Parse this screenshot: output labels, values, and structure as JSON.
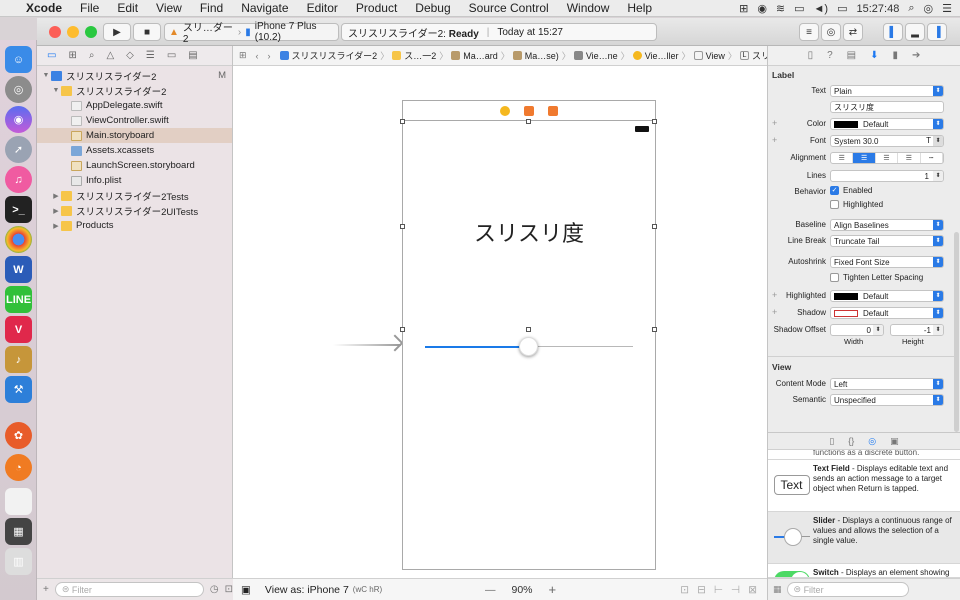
{
  "menubar": {
    "app": "Xcode",
    "items": [
      "File",
      "Edit",
      "View",
      "Find",
      "Navigate",
      "Editor",
      "Product",
      "Debug",
      "Source Control",
      "Window",
      "Help"
    ],
    "clock": "15:27:48"
  },
  "toolbar": {
    "scheme": "スリ…ダー2",
    "device": "iPhone 7 Plus (10.2)",
    "status_project": "スリスリスライダー2:",
    "status_state": "Ready",
    "status_time": "Today at 15:27"
  },
  "navigator": {
    "project": "スリスリスライダー2",
    "project_badge": "M",
    "group": "スリスリスライダー2",
    "files": [
      "AppDelegate.swift",
      "ViewController.swift",
      "Main.storyboard",
      "Assets.xcassets",
      "LaunchScreen.storyboard",
      "Info.plist"
    ],
    "groups": [
      "スリスリスライダー2Tests",
      "スリスリスライダー2UITests",
      "Products"
    ],
    "filter_placeholder": "Filter"
  },
  "jumpbar": {
    "crumbs": [
      "スリスリスライダー2",
      "ス…一2",
      "Ma…ard",
      "Ma…se)",
      "Vie…ne",
      "Vie…ller",
      "View",
      "スリスリ度"
    ]
  },
  "canvas": {
    "label_text": "スリスリ度",
    "slider_value": 0.5,
    "view_as": "View as: iPhone 7",
    "size_class": "(wC hR)",
    "zoom": "90%",
    "zoom_minus": "—",
    "zoom_plus": "+"
  },
  "inspector": {
    "section_label": "Label",
    "text_label": "Text",
    "text_value": "Plain",
    "text_content": "スリスリ度",
    "color_label": "Color",
    "color_value": "Default",
    "font_label": "Font",
    "font_value": "System 30.0",
    "alignment_label": "Alignment",
    "lines_label": "Lines",
    "lines_value": "1",
    "behavior_label": "Behavior",
    "enabled": "Enabled",
    "highlighted_cb": "Highlighted",
    "baseline_label": "Baseline",
    "baseline_value": "Align Baselines",
    "linebreak_label": "Line Break",
    "linebreak_value": "Truncate Tail",
    "autoshrink_label": "Autoshrink",
    "autoshrink_value": "Fixed Font Size",
    "tighten": "Tighten Letter Spacing",
    "highlighted_label": "Highlighted",
    "highlighted_value": "Default",
    "shadow_label": "Shadow",
    "shadow_value": "Default",
    "shadow_offset_label": "Shadow Offset",
    "shadow_w": "0",
    "shadow_h": "-1",
    "width_label": "Width",
    "height_label": "Height",
    "section_view": "View",
    "content_mode_label": "Content Mode",
    "content_mode_value": "Left",
    "semantic_label": "Semantic",
    "semantic_value": "Unspecified"
  },
  "library": {
    "cut_text": "functions as a discrete button.",
    "items": [
      {
        "title": "Text Field",
        "desc": " - Displays editable text and sends an action message to a target object when Return is tapped.",
        "icon": "Text"
      },
      {
        "title": "Slider",
        "desc": " - Displays a continuous range of values and allows the selection of a single value.",
        "icon": "slider"
      },
      {
        "title": "Switch",
        "desc": " - Displays an element showing the boolean state of a value. Allows tapping the control to toggle t…",
        "icon": "switch"
      }
    ],
    "filter_placeholder": "Filter"
  }
}
